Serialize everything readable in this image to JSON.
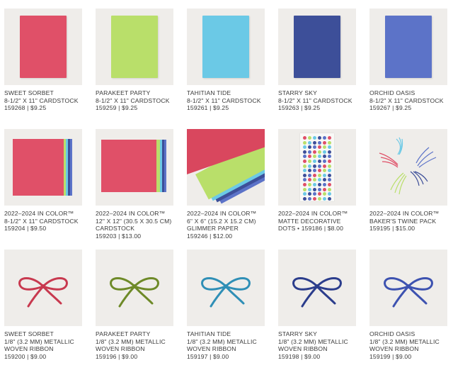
{
  "products": [
    {
      "name": "SWEET SORBET",
      "lines": [
        "SWEET SORBET",
        "8-1/2\" X 11\" CARDSTOCK",
        "159268 | $9.25"
      ],
      "color": "#e05068"
    },
    {
      "name": "PARAKEET PARTY",
      "lines": [
        "PARAKEET PARTY",
        "8-1/2\" X 11\" CARDSTOCK",
        "159259 | $9.25"
      ],
      "color": "#b9df6a"
    },
    {
      "name": "TAHITIAN TIDE",
      "lines": [
        "TAHITIAN TIDE",
        "8-1/2\" X 11\" CARDSTOCK",
        "159261 | $9.25"
      ],
      "color": "#6bc9e6"
    },
    {
      "name": "STARRY SKY",
      "lines": [
        "STARRY SKY",
        "8-1/2\" X 11\" CARDSTOCK",
        "159263 | $9.25"
      ],
      "color": "#3d4f99"
    },
    {
      "name": "ORCHID OASIS",
      "lines": [
        "ORCHID OASIS",
        "8-1/2\" X 11\" CARDSTOCK",
        "159267 | $9.25"
      ],
      "color": "#5c73c8"
    },
    {
      "name": "2022–2024 IN COLOR™",
      "lines": [
        "2022–2024 IN COLOR™",
        "8-1/2\" X 11\" CARDSTOCK",
        "159204 | $9.50"
      ]
    },
    {
      "name": "2022–2024 IN COLOR™",
      "lines": [
        "2022–2024 IN COLOR™",
        "12\" X 12\" (30.5 X 30.5 CM)",
        "CARDSTOCK",
        "159203 | $13.00"
      ]
    },
    {
      "name": "2022–2024 IN COLOR™",
      "lines": [
        "2022–2024 IN COLOR™",
        "6\" X 6\" (15.2 X 15.2 CM)",
        "GLIMMER PAPER",
        "159246 | $12.00"
      ]
    },
    {
      "name": "2022–2024 IN COLOR™",
      "lines": [
        "2022–2024 IN COLOR™",
        "MATTE DECORATIVE",
        "DOTS • 159186 | $8.00"
      ]
    },
    {
      "name": "2022–2024 IN COLOR™",
      "lines": [
        "2022–2024 IN COLOR™",
        "BAKER'S TWINE PACK",
        "159195 | $15.00"
      ]
    },
    {
      "name": "SWEET SORBET",
      "lines": [
        "SWEET SORBET",
        "1/8\" (3.2 MM) METALLIC",
        "WOVEN RIBBON",
        "159200 | $9.00"
      ],
      "color": "#c8394f"
    },
    {
      "name": "PARAKEET PARTY",
      "lines": [
        "PARAKEET PARTY",
        "1/8\" (3.2 MM) METALLIC",
        "WOVEN RIBBON",
        "159196 | $9.00"
      ],
      "color": "#6e8a28"
    },
    {
      "name": "TAHITIAN TIDE",
      "lines": [
        "TAHITIAN TIDE",
        "1/8\" (3.2 MM) METALLIC",
        "WOVEN RIBBON",
        "159197 | $9.00"
      ],
      "color": "#2f8fb6"
    },
    {
      "name": "STARRY SKY",
      "lines": [
        "STARRY SKY",
        "1/8\" (3.2 MM) METALLIC",
        "WOVEN RIBBON",
        "159198 | $9.00"
      ],
      "color": "#2b3d8c"
    },
    {
      "name": "ORCHID OASIS",
      "lines": [
        "ORCHID OASIS",
        "1/8\" (3.2 MM) METALLIC",
        "WOVEN RIBBON",
        "159199 | $9.00"
      ],
      "color": "#3d52b0"
    }
  ],
  "palette": [
    "#e05068",
    "#b9df6a",
    "#6bc9e6",
    "#3d4f99",
    "#5c73c8"
  ]
}
